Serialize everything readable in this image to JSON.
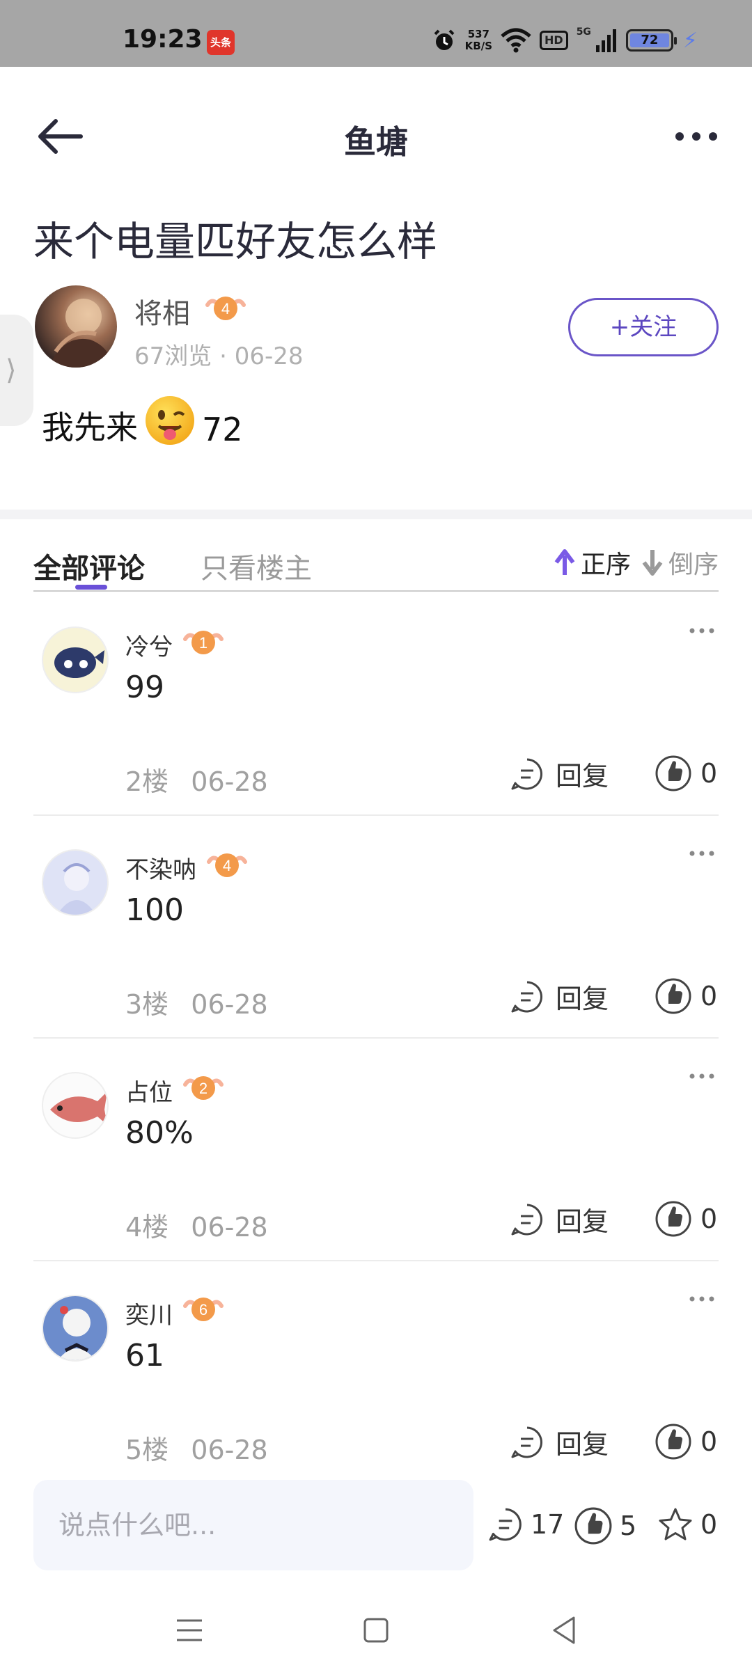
{
  "status_bar": {
    "time": "19:23",
    "app_badge": "头条",
    "net_speed_value": "537",
    "net_speed_unit": "KB/S",
    "hd_label": "HD",
    "network_label": "5G",
    "battery_level": "72"
  },
  "nav": {
    "title": "鱼塘"
  },
  "post": {
    "title": "来个电量匹好友怎么样",
    "author_name": "将相",
    "author_level": "4",
    "views": "67浏览",
    "date": "06-28",
    "follow_label": "+关注",
    "body_before": "我先来",
    "body_after": "72"
  },
  "tabs": {
    "all_comments": "全部评论",
    "op_only": "只看楼主",
    "sort_asc": "正序",
    "sort_desc": "倒序"
  },
  "comments": [
    {
      "name": "冷兮",
      "level": "1",
      "text": "99",
      "floor": "2楼",
      "date": "06-28",
      "reply_label": "回复",
      "likes": "0"
    },
    {
      "name": "不染呐",
      "level": "4",
      "text": "100",
      "floor": "3楼",
      "date": "06-28",
      "reply_label": "回复",
      "likes": "0"
    },
    {
      "name": "占位",
      "level": "2",
      "text": "80%",
      "floor": "4楼",
      "date": "06-28",
      "reply_label": "回复",
      "likes": "0"
    },
    {
      "name": "奕川",
      "level": "6",
      "text": "61",
      "floor": "5楼",
      "date": "06-28",
      "reply_label": "回复",
      "likes": "0"
    }
  ],
  "bottom_bar": {
    "input_placeholder": "说点什么吧...",
    "comment_count": "17",
    "like_count": "5",
    "favorite_count": "0"
  },
  "colors": {
    "accent": "#6a50d8",
    "badge_orange": "#f39a4a",
    "status_bar_bg": "#a6a6a6"
  }
}
